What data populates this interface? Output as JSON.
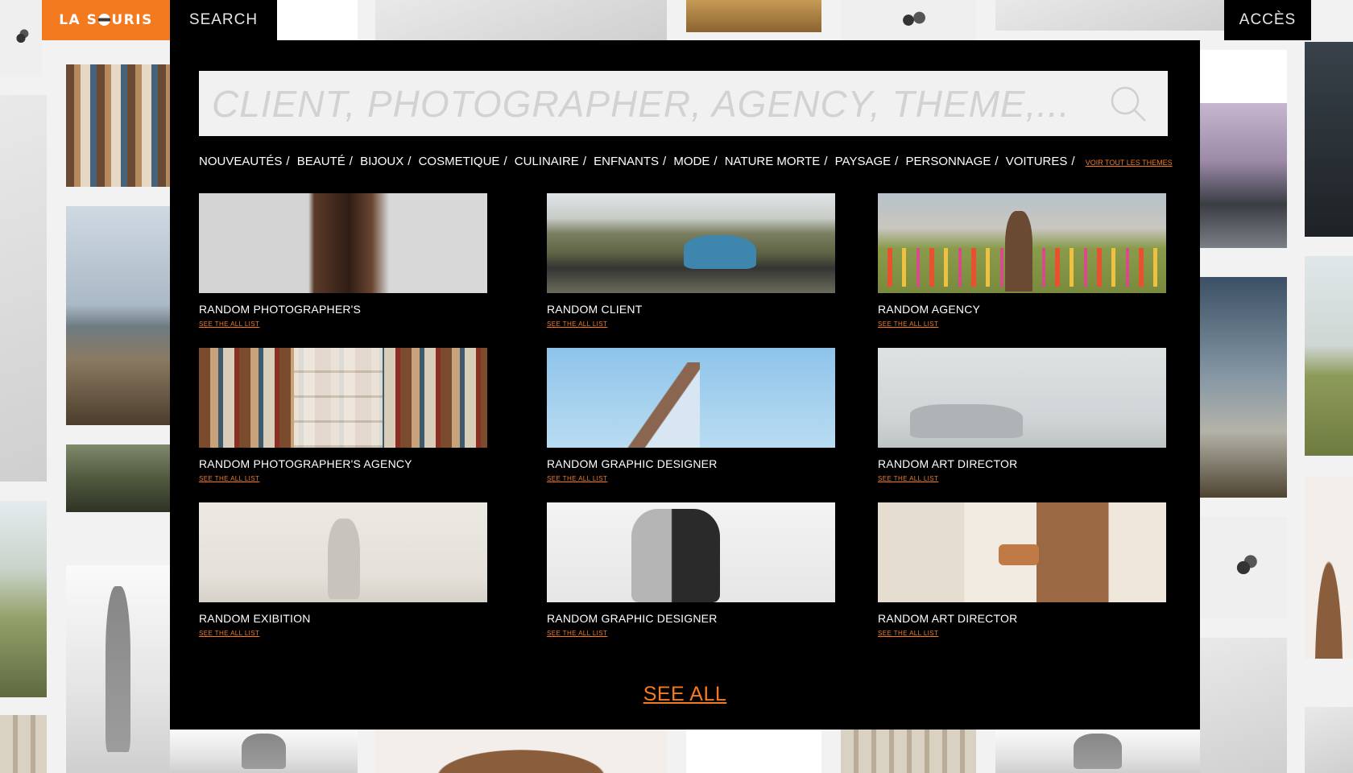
{
  "header": {
    "logo_text_left": "LA S",
    "logo_text_right": "URIS",
    "search_tab": "SEARCH",
    "access_button": "ACCÈS"
  },
  "search": {
    "placeholder": "CLIENT, PHOTOGRAPHER, AGENCY, THEME,..."
  },
  "themes": {
    "items": [
      "NOUVEAUTÉS",
      "BEAUTÉ",
      "BIJOUX",
      "COSMETIQUE",
      "CULINAIRE",
      "ENFNANTS",
      "MODE",
      "NATURE MORTE",
      "PAYSAGE",
      "PERSONNAGE",
      "VOITURES"
    ],
    "separator": "/",
    "see_all_themes": "VOIR TOUT LES THEMES"
  },
  "cards": [
    {
      "title": "RANDOM PHOTOGRAPHER'S",
      "link": "SEE THE ALL LIST",
      "image": "beauty-portrait"
    },
    {
      "title": "RANDOM CLIENT",
      "link": "SEE THE ALL LIST",
      "image": "blue-car-road"
    },
    {
      "title": "RANDOM AGENCY",
      "link": "SEE THE ALL LIST",
      "image": "man-traffic-cones"
    },
    {
      "title": "RANDOM PHOTOGRAPHER'S AGENCY",
      "link": "SEE THE ALL LIST",
      "image": "bookshelf-phone"
    },
    {
      "title": "RANDOM GRAPHIC DESIGNER",
      "link": "SEE THE ALL LIST",
      "image": "building-sky"
    },
    {
      "title": "RANDOM ART DIRECTOR",
      "link": "SEE THE ALL LIST",
      "image": "suv-climbers"
    },
    {
      "title": "RANDOM EXIBITION",
      "link": "SEE THE ALL LIST",
      "image": "painter-wall"
    },
    {
      "title": "RANDOM GRAPHIC DESIGNER",
      "link": "SEE THE ALL LIST",
      "image": "dancers-bw"
    },
    {
      "title": "RANDOM ART DIRECTOR",
      "link": "SEE THE ALL LIST",
      "image": "woman-watch"
    }
  ],
  "see_all": "SEE ALL",
  "colors": {
    "accent": "#f47a20",
    "panel": "#000000",
    "search_bg": "#f1f1f1"
  }
}
